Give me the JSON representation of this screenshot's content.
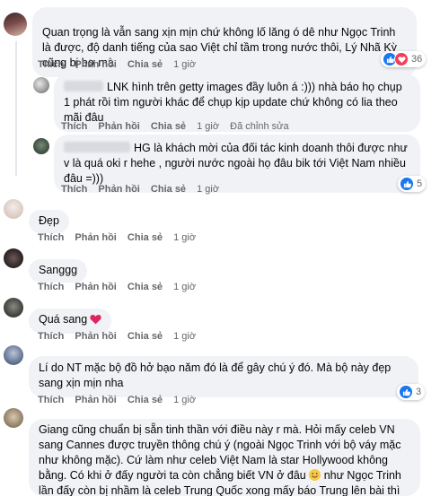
{
  "labels": {
    "like": "Thích",
    "reply": "Phản hồi",
    "share": "Chia sẻ",
    "edited": "Đã chỉnh sửa"
  },
  "colors": {
    "like": "#1877f2",
    "heart": "#f33e58",
    "bubble": "#f0f2f5",
    "meta": "#65676b"
  },
  "comments": [
    {
      "text": "Quan trọng là vẫn sang xịn mịn chứ không lố lăng ó dê như Ngọc Trinh là được, độ danh tiếng của sao Việt chỉ tầm trong nước thôi, Lý Nhã Kỳ cũng bị bơ mà",
      "time": "1 giờ",
      "reactions": [
        "like",
        "heart"
      ],
      "reaction_count": "36"
    },
    {
      "text": "LNK hình trên getty images đầy luôn á :))) nhà báo họ chụp 1 phát rồi tìm người khác để chụp kịp update chứ không có lia theo mãi đâu",
      "time": "1 giờ"
    },
    {
      "text": "HG là khách mời của đối tác kinh doanh thôi được như v là quá oki r hehe , người nước ngoài họ đâu bik tới Việt Nam nhiều đâu =)))",
      "time": "1 giờ",
      "reactions": [
        "like"
      ],
      "reaction_count": "5"
    },
    {
      "text": "Đẹp",
      "time": "1 giờ"
    },
    {
      "text": "Sanggg",
      "time": "1 giờ"
    },
    {
      "text": "Quá sang",
      "time": "1 giờ"
    },
    {
      "text": "Lí do NT mặc bộ đồ hở bạo năm đó là để gây chú ý đó. Mà bộ này đẹp sang xịn mịn nha",
      "time": "1 giờ",
      "reactions": [
        "like"
      ],
      "reaction_count": "3"
    },
    {
      "text_a": "Giang cũng chuẩn bị sẵn tinh thần với điều này r mà. Hỏi mấy celeb VN sang Cannes được truyền thông chú ý (ngoài Ngọc Trinh với bộ váy mặc như không mặc). Cứ làm như celeb Việt Nam là star Hollywood không bằng. Có khi ở đấy người ta còn chẳng biết VN ở đâu",
      "text_b": "như Ngọc Trinh lần đấy còn bị nhầm là celeb Trung Quốc xong mấy báo Trung lên bài thì mới biết là celeb VN"
    }
  ]
}
